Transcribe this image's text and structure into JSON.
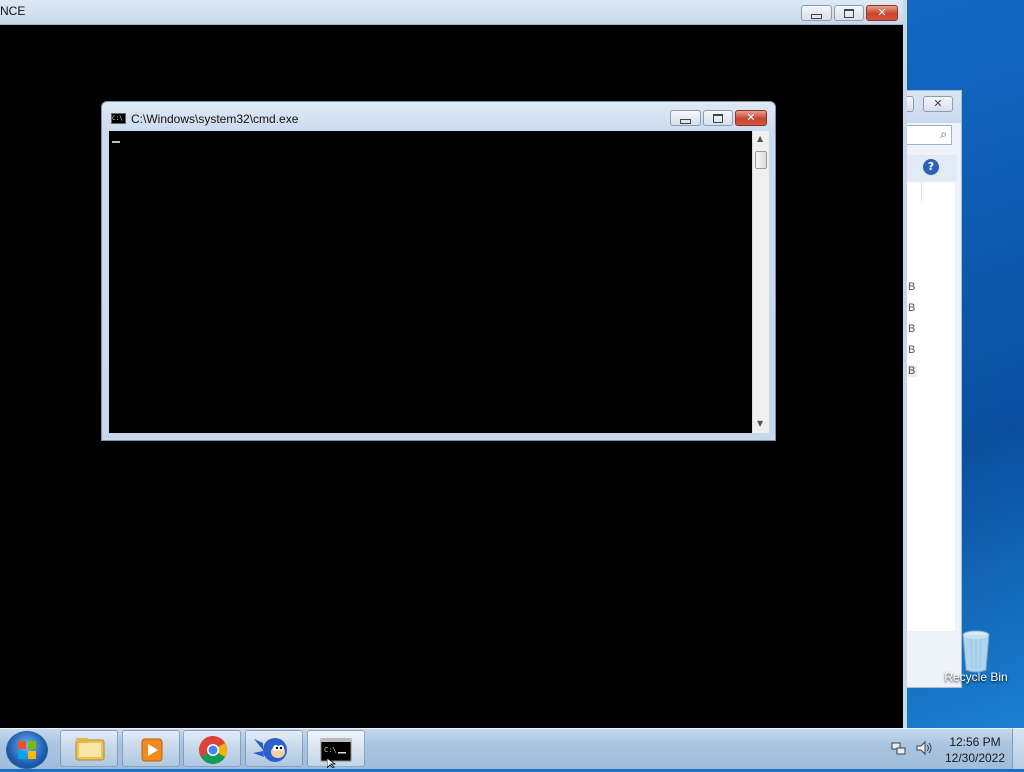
{
  "background_window": {
    "title": "NCE"
  },
  "cmd_window": {
    "icon_text": "C:\\",
    "title": "C:\\Windows\\system32\\cmd.exe"
  },
  "right_window": {
    "size_column": [
      "B",
      "B",
      "B",
      "B",
      "B"
    ]
  },
  "desktop": {
    "recycle_bin_label": "Recycle Bin"
  },
  "taskbar": {
    "items": [
      {
        "name": "file-explorer"
      },
      {
        "name": "media-player"
      },
      {
        "name": "chrome"
      },
      {
        "name": "sonic-game"
      },
      {
        "name": "command-prompt",
        "active": true
      }
    ],
    "clock_time": "12:56 PM",
    "clock_date": "12/30/2022"
  }
}
